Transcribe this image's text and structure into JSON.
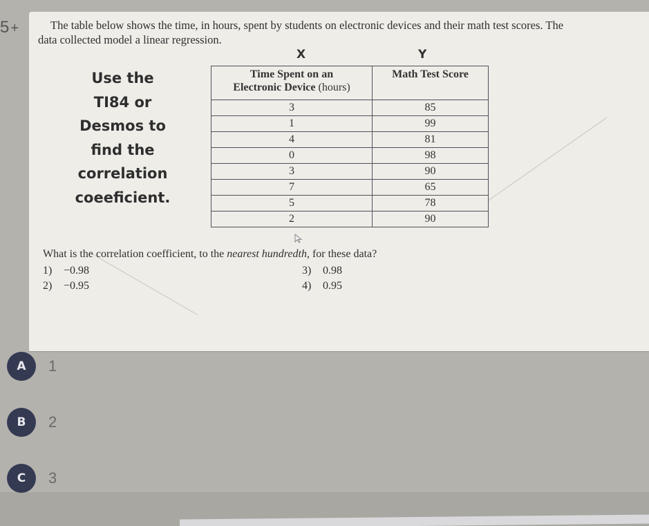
{
  "question": {
    "number": "5",
    "expand_icon": "plus-icon",
    "prompt_line1": "The table below shows the time, in hours, spent by students on electronic devices and their math test scores.  The",
    "prompt_line2": "data collected model a linear regression.",
    "x_label": "X",
    "y_label": "Y",
    "note_lines": [
      "Use the",
      "TI84 or",
      "Desmos to",
      "find the",
      "correlation",
      "coeeficient."
    ],
    "table": {
      "headers": [
        {
          "bold": "Time Spent on an Electronic Device",
          "unit": "(hours)"
        },
        {
          "bold": "Math Test Score",
          "unit": ""
        }
      ],
      "header_line1": "Time Spent on an",
      "header_line2_bold": "Electronic Device",
      "header_line2_unit": "(hours)",
      "rows": [
        [
          "3",
          "85"
        ],
        [
          "1",
          "99"
        ],
        [
          "4",
          "81"
        ],
        [
          "0",
          "98"
        ],
        [
          "3",
          "90"
        ],
        [
          "7",
          "65"
        ],
        [
          "5",
          "78"
        ],
        [
          "2",
          "90"
        ]
      ]
    },
    "ask_prefix": "What is the correlation coefficient, to the ",
    "ask_italic": "nearest hundredth",
    "ask_suffix": ", for these data?",
    "choices": [
      {
        "num": "1)",
        "value": "−0.98"
      },
      {
        "num": "2)",
        "value": "−0.95"
      },
      {
        "num": "3)",
        "value": "0.98"
      },
      {
        "num": "4)",
        "value": "0.95"
      }
    ]
  },
  "answers": [
    {
      "letter": "A",
      "text": "1"
    },
    {
      "letter": "B",
      "text": "2"
    },
    {
      "letter": "C",
      "text": "3"
    }
  ],
  "colors": {
    "badge": "#343a52",
    "card": "#eeede8",
    "background": "#b4b2ad"
  }
}
